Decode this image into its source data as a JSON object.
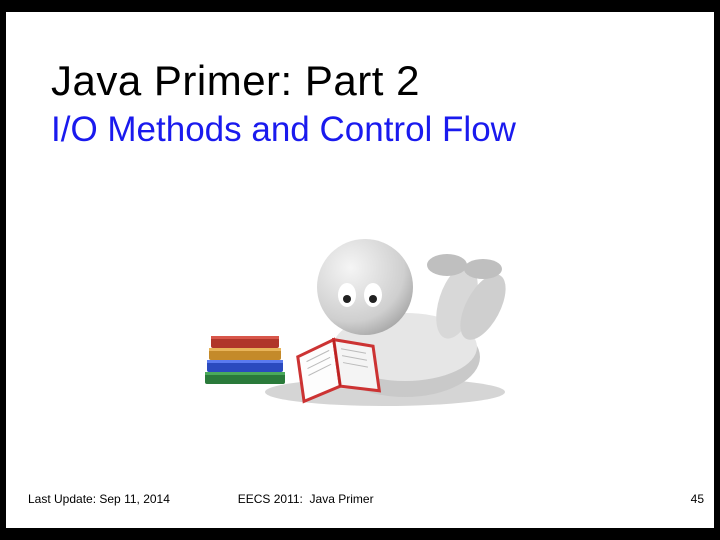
{
  "slide": {
    "title": "Java Primer:   Part 2",
    "subtitle": "I/O Methods and Control Flow",
    "footer_left": "Last Update: Sep 11, 2014",
    "footer_center": "EECS 2011:  Java Primer",
    "page_number": "45"
  }
}
